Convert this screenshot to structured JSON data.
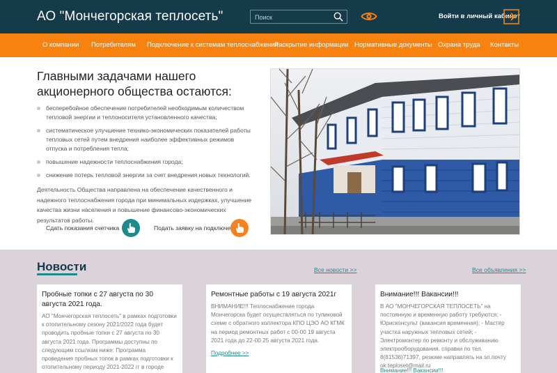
{
  "header": {
    "logo": "АО \"Мончегорская теплосеть\"",
    "search_placeholder": "Поиск",
    "cabinet_label": "Войти в личный кабинет"
  },
  "nav": {
    "items": [
      "О компании",
      "Потребителям",
      "Подключение к системам теплоснабжения",
      "Раскрытие информации",
      "Нормативные документы",
      "Охрана труда",
      "Контакты"
    ]
  },
  "hero": {
    "title": "Главными задачами нашего акционерного общества остаются:",
    "bullets": [
      "бесперебойное обеспечение потребителей необходимым количеством тепловой энергии и теплоносителя установленного качества;",
      "систематическое улучшение технико-экономических показателей работы тепловых сетей путем внедрения наиболее эффективных режимов отпуска и потребления тепла;",
      "повышение надежности теплоснабжения города;",
      "снижение потерь тепловой энергии за счет внедрения новых технологий."
    ],
    "paragraph": "Деятельность Общества направлена на обеспечение качественного и надежного теплоснабжения города при минимальных издержках, улучшение качества жизни населения и повышение финансово-экономических результатов работы.",
    "action_meter": "Сдать показания счетчика",
    "action_connect": "Подать заявку на подключение"
  },
  "news": {
    "title": "Новости",
    "all_news": "Все новости >>",
    "all_ads": "Все объявления >>",
    "cards": [
      {
        "title": "Пробные топки с 27 августа по 30 августа 2021 года.",
        "text": "АО \"Мончегорская теплосеть\" в рамках подготовки к отопительному сезону 2021/2022 года будет проводить пробные топки с 27 августа по 30 августа 2021 года. Программы доступны по следующим ссылкам ниже: Программа проведения пробных топок в рамках подготовки к отопительному периоду 2021-2022 гг в городе Мончегорске Программа",
        "more": ""
      },
      {
        "title": "Ремонтные работы с 19 августа 2021г",
        "text": "ВНИМАНИЕ!!! Теплоснабжение города Мончегорска будет осуществляться по тупиковой схеме с обратного коллектора КПО ЦЭО АО КГМК на период ремонтных работ с 00-00 19 августа 2021 года до 22-00 25 августа 2021 года.",
        "more": "Подробнее >>"
      },
      {
        "title": "Внимание!!! Вакансии!!!",
        "text": "В АО \"МОНЧЕГОРСКАЯ ТЕПЛОСЕТЬ\" на постоянную и временную работу требуются: - Юрисконсульт (вакансия временная); - Мастер участка наружных тепловых сетей; - Электромонтер по ремонту и обслуживанию электрооборудования. справки по тел. 8(81536)71397, резюме направлять на эл.почту ok.teploset@mail.ru",
        "more": "Внимание!!! Вакансии!!!"
      }
    ]
  },
  "colors": {
    "header_bg": "#153a4a",
    "nav_bg": "#f7820f",
    "accent_teal": "#1f8a8a",
    "accent_orange": "#f58220",
    "news_bg": "#dcd2da"
  },
  "icons": [
    "search-icon",
    "eye-icon",
    "login-arrow-icon",
    "hand-pointer-icon"
  ]
}
